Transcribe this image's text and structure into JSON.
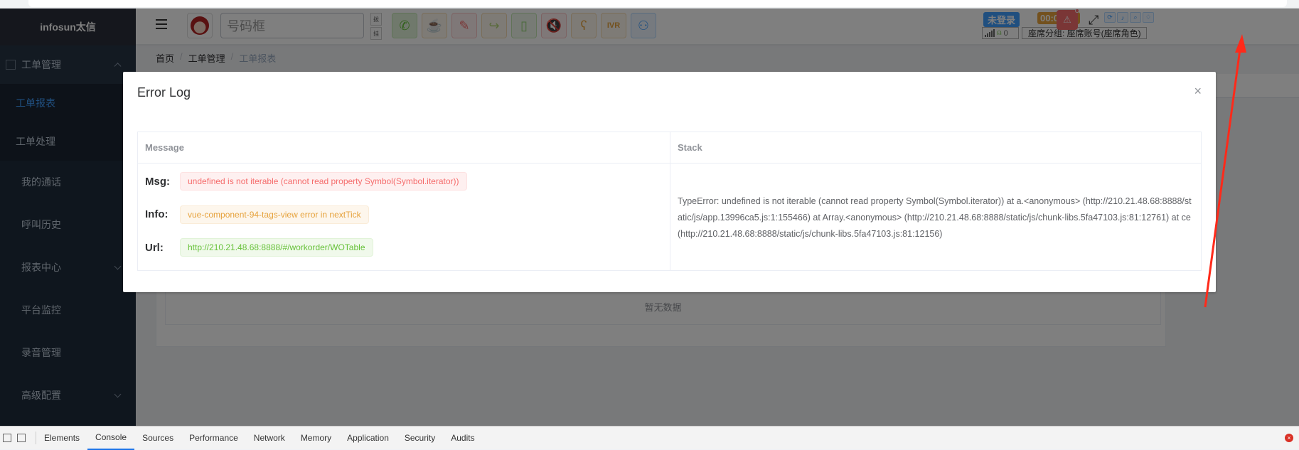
{
  "sidebar": {
    "logo": "infosun太信",
    "items": [
      {
        "label": "工单管理"
      },
      {
        "label": "工单报表"
      },
      {
        "label": "工单处理"
      },
      {
        "label": "我的通话"
      },
      {
        "label": "呼叫历史"
      },
      {
        "label": "报表中心"
      },
      {
        "label": "平台监控"
      },
      {
        "label": "录音管理"
      },
      {
        "label": "高级配置"
      }
    ]
  },
  "navbar": {
    "phone_placeholder": "号码框",
    "mini_buttons": [
      "拨",
      "挂"
    ],
    "login_status": "未登录",
    "timer": "00:00:08",
    "agent_count": "0",
    "seat_info": "座席分组: 座席账号(座席角色)",
    "bug_label": "⚠"
  },
  "breadcrumb": [
    "首页",
    "工单管理",
    "工单报表"
  ],
  "content": {
    "empty_text": "暂无数据"
  },
  "modal": {
    "title": "Error Log",
    "close": "×",
    "headers": {
      "message": "Message",
      "stack": "Stack"
    },
    "msg_label": "Msg:",
    "msg_value": "undefined is not iterable (cannot read property Symbol(Symbol.iterator))",
    "info_label": "Info:",
    "info_value": "vue-component-94-tags-view error in nextTick",
    "url_label": "Url:",
    "url_value": "http://210.21.48.68:8888/#/workorder/WOTable",
    "stack_value": "TypeError: undefined is not iterable (cannot read property Symbol(Symbol.iterator)) at a.<anonymous> (http://210.21.48.68:8888/static/js/app.13996ca5.js:1:155466) at Array.<anonymous> (http://210.21.48.68:8888/static/js/chunk-libs.5fa47103.js:81:12761) at ce (http://210.21.48.68:8888/static/js/chunk-libs.5fa47103.js:81:12156)"
  },
  "devtools": {
    "tabs": [
      "Elements",
      "Console",
      "Sources",
      "Performance",
      "Network",
      "Memory",
      "Application",
      "Security",
      "Audits"
    ],
    "active_tab": "Console"
  },
  "colors": {
    "sidebar_bg": "#1f2d3d",
    "accent": "#409eff",
    "danger": "#f56c6c",
    "warning": "#e6a23c",
    "success": "#67c23a",
    "annotation_arrow": "#ff2a1a"
  }
}
